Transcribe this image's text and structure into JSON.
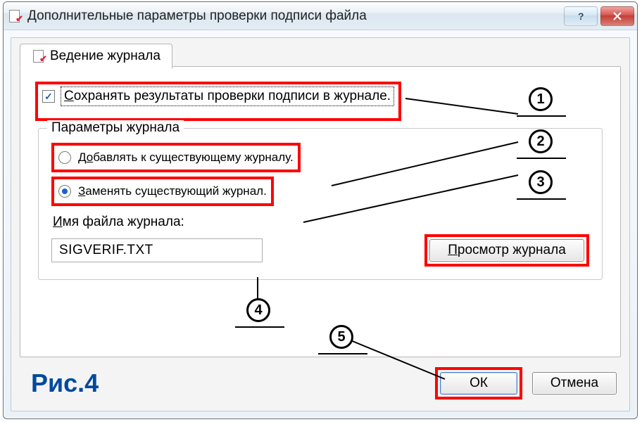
{
  "window": {
    "title": "Дополнительные параметры проверки подписи файла"
  },
  "tab": {
    "label": "Ведение журнала"
  },
  "save_checkbox": {
    "checked": true,
    "label": "Сохранять результаты проверки подписи в журнале."
  },
  "groupbox": {
    "legend": "Параметры журнала",
    "radio_append": {
      "selected": false,
      "label_pre": "Д",
      "label_under": "о",
      "label_post": "бавлять к существующему журналу."
    },
    "radio_replace": {
      "selected": true,
      "label_pre": "",
      "label_under": "З",
      "label_post": "аменять существующий журнал."
    },
    "filename_label_pre": "",
    "filename_label_under": "И",
    "filename_label_post": "мя файла журнала:",
    "filename_value": "SIGVERIF.TXT",
    "view_button_pre": "",
    "view_button_under": "П",
    "view_button_post": "росмотр журнала"
  },
  "buttons": {
    "ok": "ОК",
    "cancel": "Отмена"
  },
  "callouts": {
    "b1": "1",
    "b2": "2",
    "b3": "3",
    "b4": "4",
    "b5": "5"
  },
  "figure": "Рис.4"
}
